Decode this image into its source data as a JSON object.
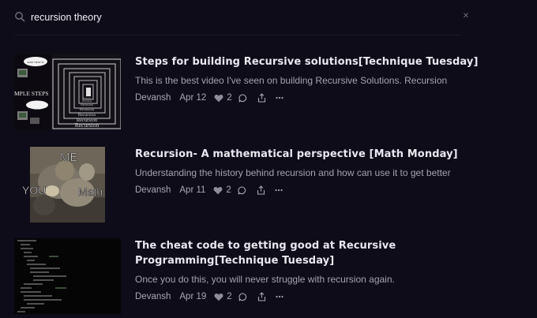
{
  "search": {
    "query": "recursion theory",
    "placeholder": ""
  },
  "results": [
    {
      "title": "Steps for building Recursive solutions[Technique Tuesday]",
      "description": "This is the best video I've seen on building Recursive Solutions. Recursion",
      "author": "Devansh",
      "date": "Apr 12",
      "likes": "2",
      "thumbnail": {
        "side_label": "MPLE STEPS",
        "bubble_text": "sure here is",
        "levels": [
          "Recursion",
          "Recursion",
          "Recursion",
          "Recursion",
          "Recursion",
          "Recursion",
          "Recursion"
        ]
      }
    },
    {
      "title": "Recursion- A mathematical perspective [Math Monday]",
      "description": "Understanding the history behind recursion and how can use it to get better",
      "author": "Devansh",
      "date": "Apr 11",
      "likes": "2",
      "thumbnail": {
        "label_me": "ME",
        "label_you": "YOU",
        "label_math": "Math"
      }
    },
    {
      "title": "The cheat code to getting good at Recursive Programming[Technique Tuesday]",
      "description": "Once you do this, you will never struggle with recursion again.",
      "author": "Devansh",
      "date": "Apr 19",
      "likes": "2",
      "thumbnail": {
        "kind": "code-screenshot"
      }
    }
  ],
  "colors": {
    "background": "#0e0c18",
    "title": "#e9e7f0",
    "muted": "#a5a2b2"
  },
  "icons": [
    "search-icon",
    "clear-icon",
    "heart-icon",
    "comment-icon",
    "share-icon",
    "more-icon"
  ]
}
